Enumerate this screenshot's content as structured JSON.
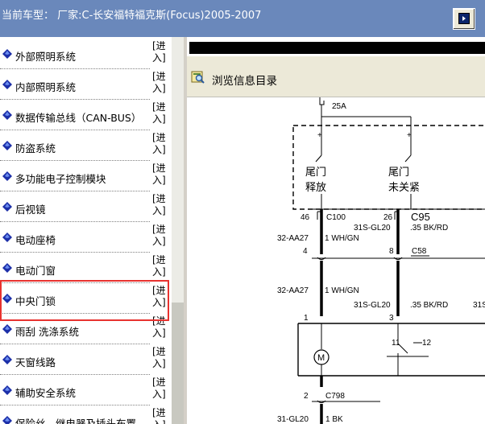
{
  "header": {
    "title": "当前车型： 厂家:C-长安福特福克斯(Focus)2005-2007"
  },
  "menu": {
    "enter_label": "[进入]",
    "items": [
      {
        "label": "外部照明系统"
      },
      {
        "label": "内部照明系统"
      },
      {
        "label": "数据传输总线（CAN-BUS）"
      },
      {
        "label": "防盗系统"
      },
      {
        "label": "多功能电子控制模块"
      },
      {
        "label": "后视镜"
      },
      {
        "label": "电动座椅"
      },
      {
        "label": "电动门窗"
      },
      {
        "label": "中央门锁"
      },
      {
        "label": "雨刮 洗涤系统"
      },
      {
        "label": "天窗线路"
      },
      {
        "label": "辅助安全系统"
      },
      {
        "label": "保险丝、继电器及插头布置"
      }
    ],
    "selected_index": 8
  },
  "viewer": {
    "toolbar_label": "浏览信息目录"
  },
  "diagram": {
    "fuse": "25A",
    "switch1": {
      "line1": "尾门",
      "line2": "释放"
    },
    "switch2": {
      "line1": "尾门",
      "line2": "未关紧"
    },
    "pin46": "46",
    "pin26": "26",
    "c100": "C100",
    "c95": "C95",
    "wire_aa27_a": "32-AA27",
    "wire_whgn_a": "1 WH/GN",
    "wire_gl20_a": "31S-GL20",
    "wire_bkrd_a": ".35 BK/RD",
    "pin4": "4",
    "pin8": "8",
    "c58": "C58",
    "wire_aa27_b": "32-AA27",
    "wire_whgn_b": "1 WH/GN",
    "wire_gl20_b": "31S-GL20",
    "wire_bkrd_b": ".35 BK/RD",
    "wire_31s_cut": "31S",
    "pin1": "1",
    "pin3": "3",
    "pin11": "11",
    "pin12": "12",
    "motor": "M",
    "pin2": "2",
    "c798": "C798",
    "wire_gl20_c": "31-GL20",
    "wire_bk": "1 BK",
    "plus1": "+",
    "plus2": "+"
  },
  "colors": {
    "header_bg": "#6a88bb",
    "highlight": "#e8322f",
    "icon_blue": "#1c2fa8"
  }
}
